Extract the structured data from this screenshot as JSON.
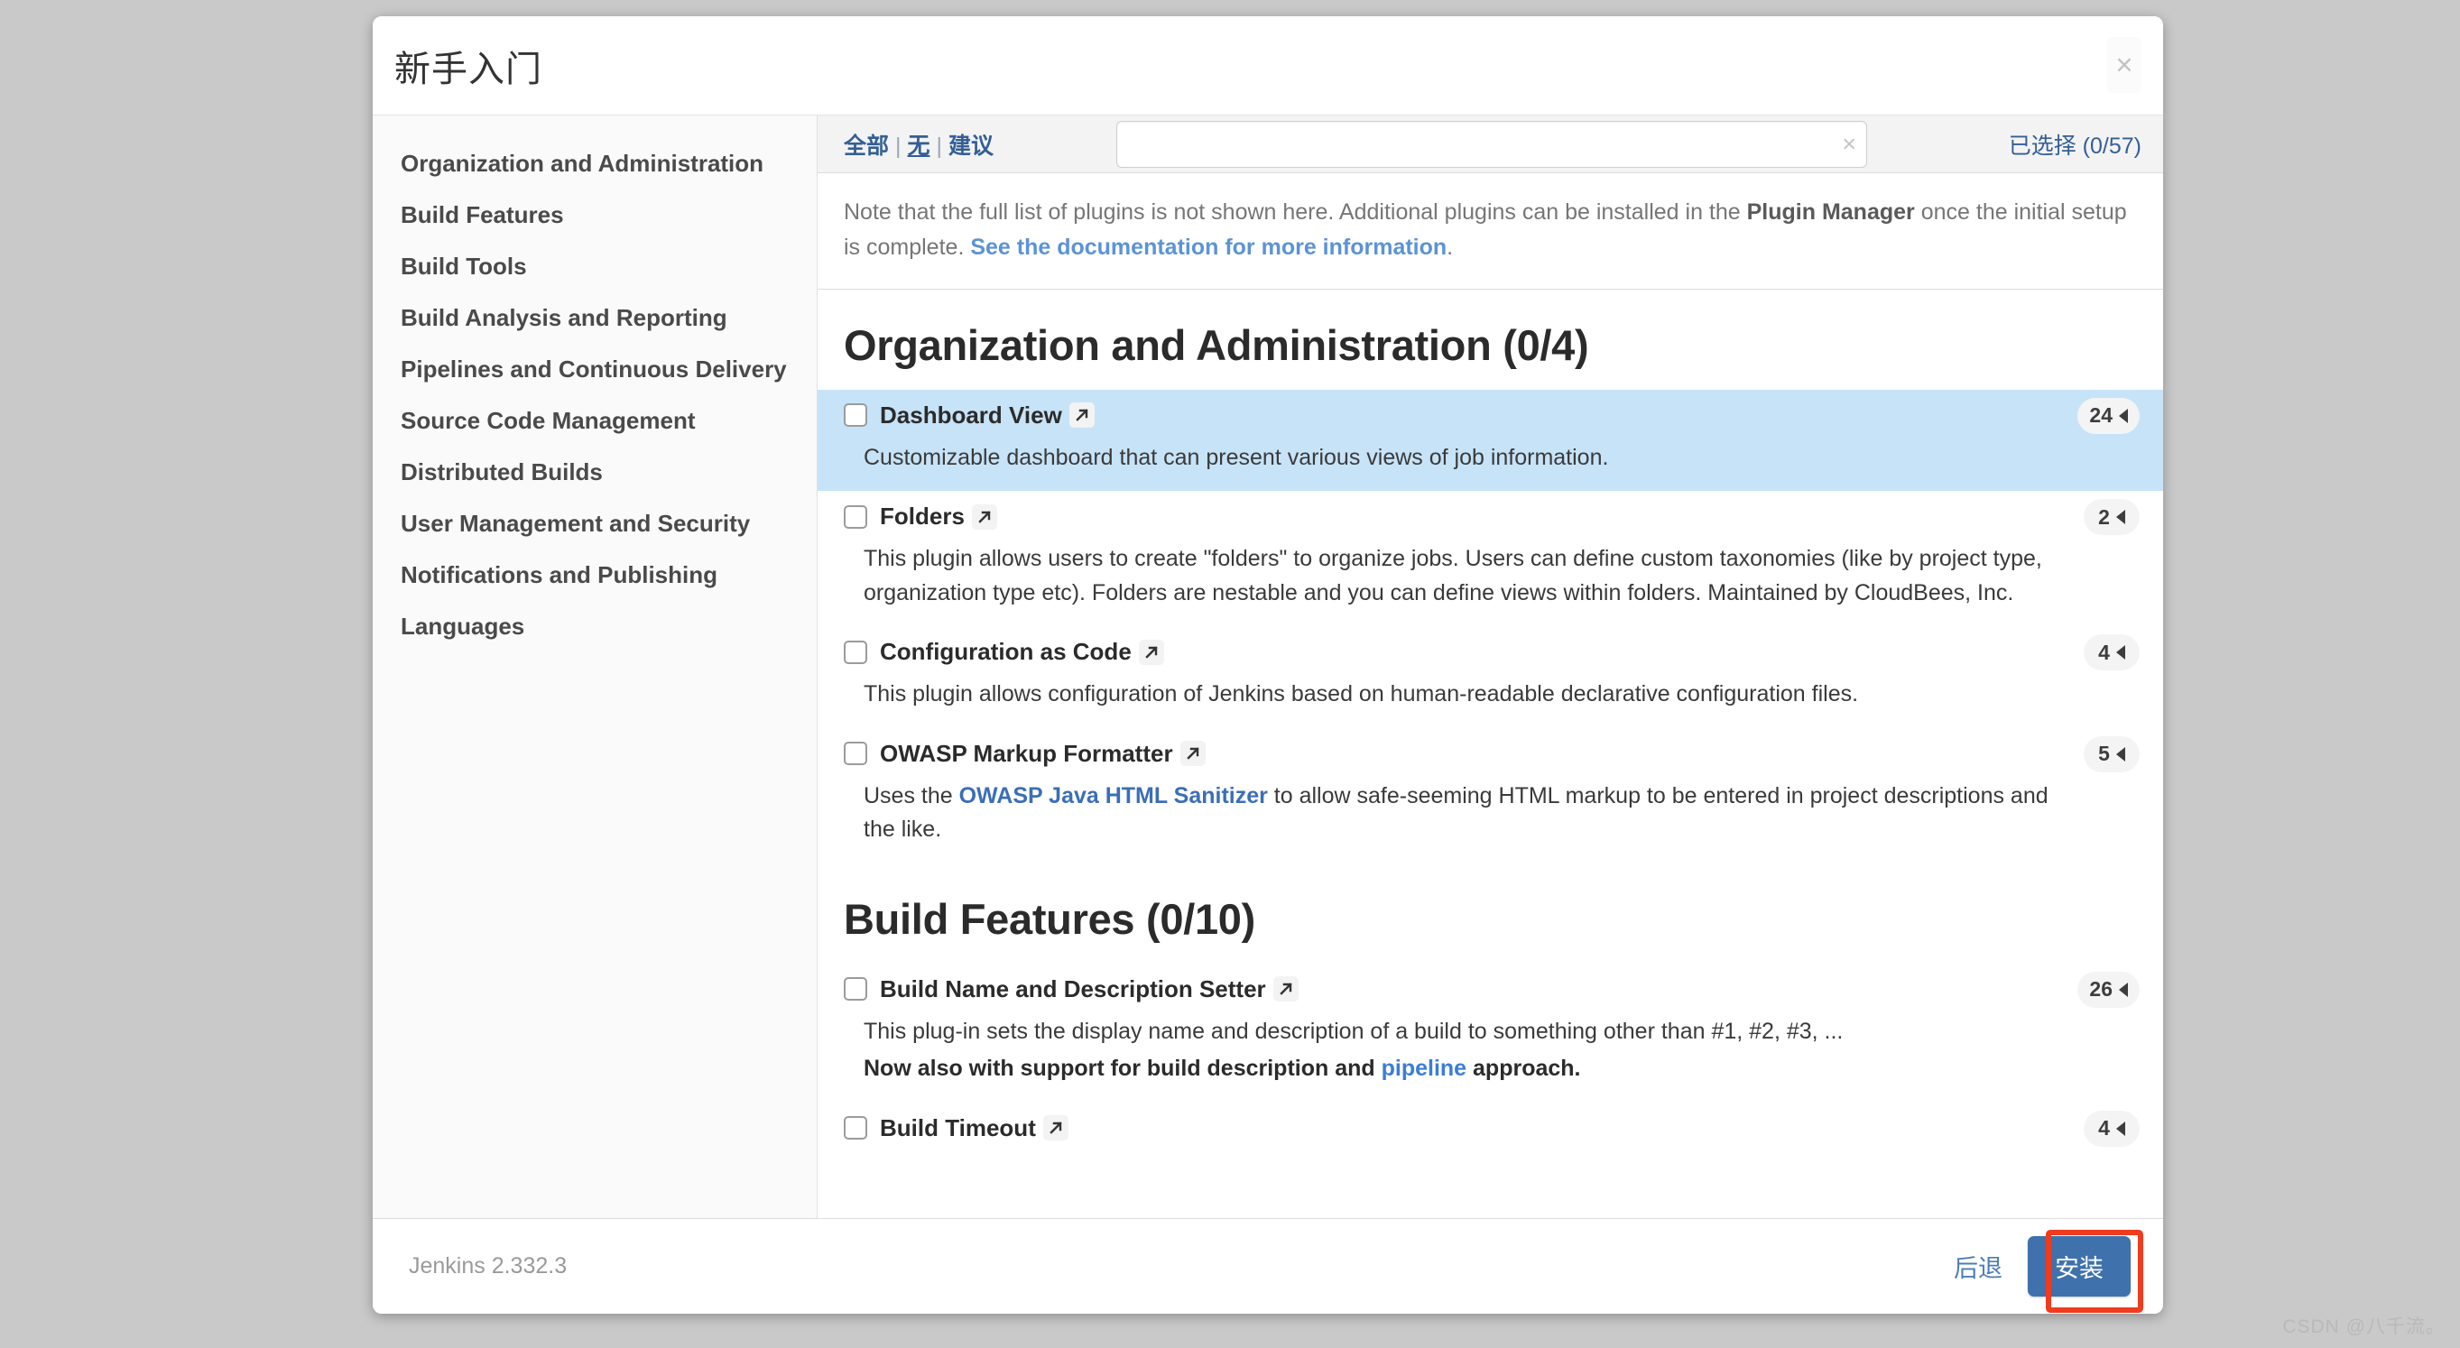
{
  "modal": {
    "title": "新手入门",
    "close_label": "×"
  },
  "sidebar": {
    "items": [
      {
        "label": "Organization and Administration"
      },
      {
        "label": "Build Features"
      },
      {
        "label": "Build Tools"
      },
      {
        "label": "Build Analysis and Reporting"
      },
      {
        "label": "Pipelines and Continuous Delivery"
      },
      {
        "label": "Source Code Management"
      },
      {
        "label": "Distributed Builds"
      },
      {
        "label": "User Management and Security"
      },
      {
        "label": "Notifications and Publishing"
      },
      {
        "label": "Languages"
      }
    ]
  },
  "toolbar": {
    "filter_all": "全部",
    "filter_none": "无",
    "filter_suggested": "建议",
    "separator": "|",
    "search_value": "",
    "search_placeholder": "",
    "clear_icon": "×",
    "selected_count": "已选择 (0/57)"
  },
  "notice": {
    "part1": "Note that the full list of plugins is not shown here. Additional plugins can be installed in the ",
    "bold": "Plugin Manager",
    "part2": " once the initial setup is complete. ",
    "link": "See the documentation for more information",
    "part3": "."
  },
  "sections": [
    {
      "title": "Organization and Administration (0/4)",
      "plugins": [
        {
          "name": "Dashboard View",
          "badge": "24",
          "desc": "Customizable dashboard that can present various views of job information.",
          "highlighted": true
        },
        {
          "name": "Folders",
          "badge": "2",
          "desc": "This plugin allows users to create \"folders\" to organize jobs. Users can define custom taxonomies (like by project type, organization type etc). Folders are nestable and you can define views within folders. Maintained by CloudBees, Inc.",
          "highlighted": false
        },
        {
          "name": "Configuration as Code",
          "badge": "4",
          "desc": "This plugin allows configuration of Jenkins based on human-readable declarative configuration files.",
          "highlighted": false
        },
        {
          "name": "OWASP Markup Formatter",
          "badge": "5",
          "desc_pre": "Uses the ",
          "desc_link": "OWASP Java HTML Sanitizer",
          "desc_post": " to allow safe-seeming HTML markup to be entered in project descriptions and the like.",
          "highlighted": false
        }
      ]
    },
    {
      "title": "Build Features (0/10)",
      "plugins": [
        {
          "name": "Build Name and Description Setter",
          "badge": "26",
          "desc": "This plug-in sets the display name and description of a build to something other than #1, #2, #3, ...",
          "bold_pre": "Now also with support for build description and ",
          "bold_link": "pipeline",
          "bold_post": " approach.",
          "highlighted": false
        },
        {
          "name": "Build Timeout",
          "badge": "4",
          "desc": "",
          "highlighted": false
        }
      ]
    }
  ],
  "footer": {
    "version": "Jenkins 2.332.3",
    "back_label": "后退",
    "install_label": "安装"
  },
  "watermark": "CSDN @八千流。",
  "colors": {
    "accent": "#3f72ad",
    "link": "#335f96",
    "highlight_row": "#c7e3f8",
    "annotation": "#f03b1e"
  }
}
